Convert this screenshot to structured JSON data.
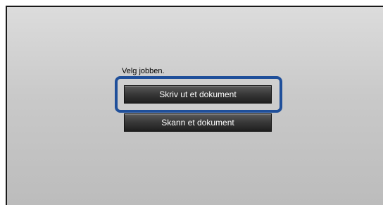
{
  "screen": {
    "prompt": "Velg jobben.",
    "options": [
      {
        "label": "Skriv ut et dokument",
        "selected": true
      },
      {
        "label": "Skann et dokument",
        "selected": false
      }
    ]
  },
  "colors": {
    "highlight": "#1f4f9a",
    "button": "#2a2a2a",
    "screen_background": "#c9c9c9"
  }
}
